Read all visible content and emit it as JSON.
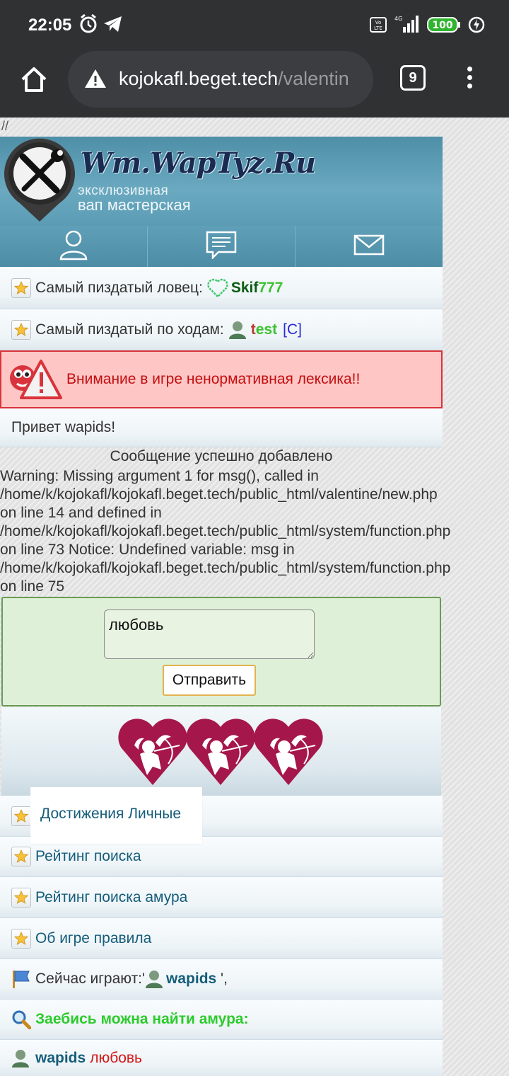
{
  "status_bar": {
    "time": "22:05",
    "battery": "100",
    "network": "4G",
    "volte": "Vo LTE"
  },
  "browser": {
    "url_host": "kojokafl.beget.tech",
    "url_path": "/valentin",
    "tab_count": "9"
  },
  "top_text": "//",
  "header": {
    "title": "Wm.WapTyz.Ru",
    "subtitle_line1": "эксклюзивная",
    "subtitle_line2": "вап мастерская"
  },
  "info": {
    "best_hunter_label": "Самый пиздатый ловец:",
    "best_hunter_user_part1": "Skif",
    "best_hunter_user_part2": "777",
    "best_moves_label": "Самый пиздатый по ходам:",
    "best_moves_user_part1": "t",
    "best_moves_user_part2": "est",
    "best_moves_tag": "[C]"
  },
  "alert": {
    "text": "Внимание в игре ненормативная лексика!!"
  },
  "greeting": "Привет wapids!",
  "success_message": "Сообщение успешно добавлено",
  "warning_lines": [
    "Warning: Missing argument 1 for msg(), called in",
    "/home/k/kojokafl/kojokafl.beget.tech/public_html/valentine/new.php",
    "on line 14 and defined in",
    "/home/k/kojokafl/kojokafl.beget.tech/public_html/system/function.php",
    "on line 73 Notice: Undefined variable: msg in",
    "/home/k/kojokafl/kojokafl.beget.tech/public_html/system/function.php",
    "on line 75"
  ],
  "form": {
    "message_value": "любовь",
    "submit_label": "Отправить"
  },
  "menu": {
    "achievements": "Достижения Личные",
    "search_rating": "Рейтинг поиска",
    "cupid_rating": "Рейтинг поиска амура",
    "rules": "Об игре правила"
  },
  "playing_now": {
    "label": "Сейчас играют:'",
    "user": "wapids",
    "suffix": " ',"
  },
  "find_cupid": "Заебись можна найти амура:",
  "last_entry": {
    "user": "wapids",
    "word": "любовь"
  },
  "colors": {
    "accent": "#5b9cb4",
    "alert_bg": "#ffc6c6",
    "alert_text": "#c30f0f",
    "form_bg": "#dff0d8",
    "heart": "#a5174a"
  }
}
